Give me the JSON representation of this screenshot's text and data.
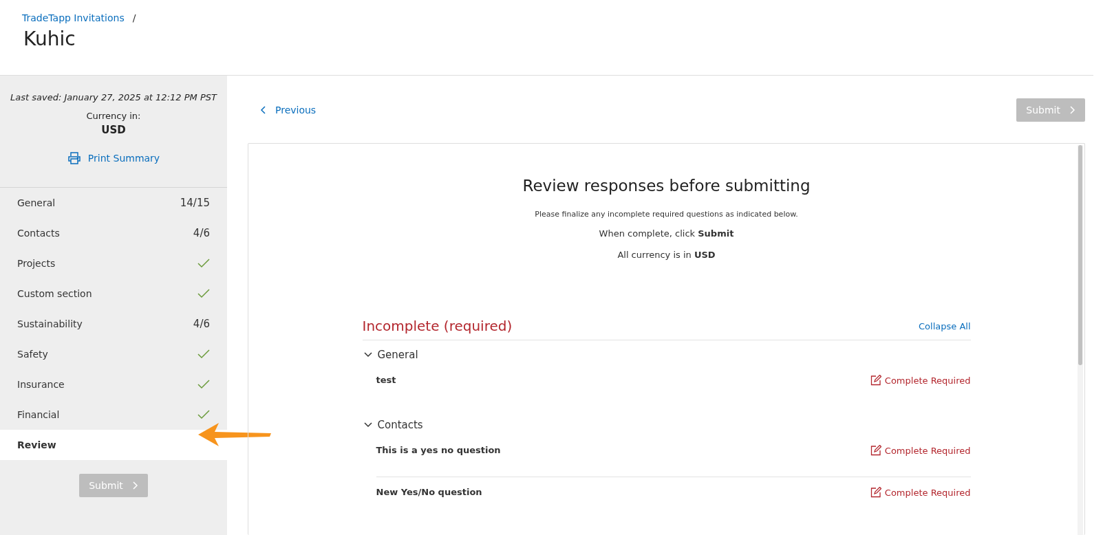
{
  "header": {
    "breadcrumb": "TradeTapp Invitations",
    "separator": "/",
    "title": "Kuhic"
  },
  "sidebar": {
    "last_saved": "Last saved: January 27, 2025 at 12:12 PM PST",
    "currency_label": "Currency in:",
    "currency": "USD",
    "print_link": "Print Summary",
    "items": [
      {
        "label": "General",
        "complete": false,
        "progress": "14/15",
        "selected": false
      },
      {
        "label": "Contacts",
        "complete": false,
        "progress": "4/6",
        "selected": false
      },
      {
        "label": "Projects",
        "complete": true,
        "selected": false
      },
      {
        "label": "Custom section",
        "complete": true,
        "selected": false
      },
      {
        "label": "Sustainability",
        "complete": false,
        "progress": "4/6",
        "selected": false
      },
      {
        "label": "Safety",
        "complete": true,
        "selected": false
      },
      {
        "label": "Insurance",
        "complete": true,
        "selected": false
      },
      {
        "label": "Financial",
        "complete": true,
        "selected": false
      },
      {
        "label": "Review",
        "complete": false,
        "selected": true
      }
    ],
    "submit": {
      "label": "Submit",
      "disabled": true
    }
  },
  "toolbar": {
    "previous": "Previous",
    "submit": {
      "label": "Submit",
      "disabled": true
    }
  },
  "review": {
    "title": "Review responses before submitting",
    "instruction": "Please finalize any incomplete required questions as indicated below.",
    "submit_hint": "When complete, click **Submit**",
    "currency_note": "All currency is in **USD**",
    "group_title": "Incomplete (required)",
    "collapse_all": "Collapse All",
    "sections": [
      {
        "name": "General",
        "expanded": true,
        "questions": [
          {
            "text": "test",
            "action": "Complete Required"
          }
        ]
      },
      {
        "name": "Contacts",
        "expanded": true,
        "questions": [
          {
            "text": "This is a yes no question",
            "action": "Complete Required"
          },
          {
            "text": "New Yes/No question",
            "action": "Complete Required"
          }
        ]
      }
    ]
  }
}
